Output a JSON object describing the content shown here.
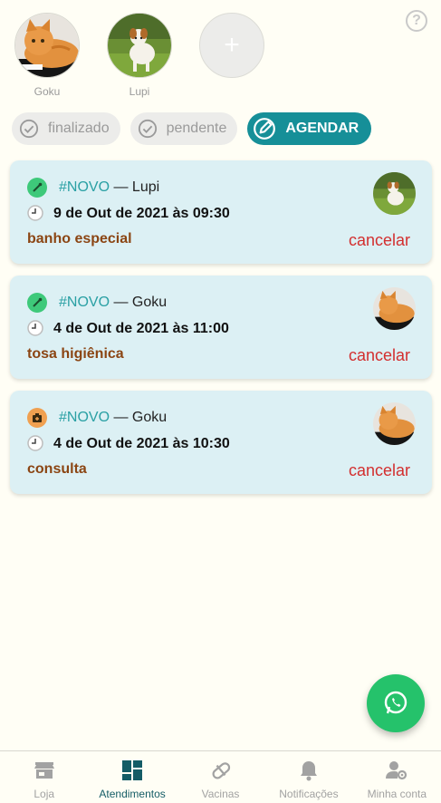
{
  "pets": [
    {
      "name": "Goku"
    },
    {
      "name": "Lupi"
    }
  ],
  "add_pet_label": "+",
  "filters": {
    "finalizado": "finalizado",
    "pendente": "pendente",
    "agendar": "AGENDAR"
  },
  "appointments": [
    {
      "tag": "#NOVO",
      "separator": "—",
      "pet": "Lupi",
      "date": "9 de Out de 2021 às 09:30",
      "service": "banho especial",
      "cancel": "cancelar",
      "type_icon": "grooming-icon",
      "type_color": "#3ec97a"
    },
    {
      "tag": "#NOVO",
      "separator": "—",
      "pet": "Goku",
      "date": "4 de Out de 2021 às 11:00",
      "service": "tosa higiênica",
      "cancel": "cancelar",
      "type_icon": "grooming-icon",
      "type_color": "#3ec97a"
    },
    {
      "tag": "#NOVO",
      "separator": "—",
      "pet": "Goku",
      "date": "4 de Out de 2021 às 10:30",
      "service": "consulta",
      "cancel": "cancelar",
      "type_icon": "vet-kit-icon",
      "type_color": "#f0a050"
    }
  ],
  "nav": [
    {
      "label": "Loja",
      "icon": "store-icon"
    },
    {
      "label": "Atendimentos",
      "icon": "dashboard-icon",
      "active": true
    },
    {
      "label": "Vacinas",
      "icon": "pill-icon"
    },
    {
      "label": "Notificações",
      "icon": "bell-icon"
    },
    {
      "label": "Minha conta",
      "icon": "account-settings-icon"
    }
  ],
  "colors": {
    "accent": "#168f98",
    "nav_active": "#145c66",
    "cancel": "#d32f2f",
    "service": "#8b4513",
    "whatsapp": "#25c26b",
    "card_bg": "#dcf0f4"
  }
}
